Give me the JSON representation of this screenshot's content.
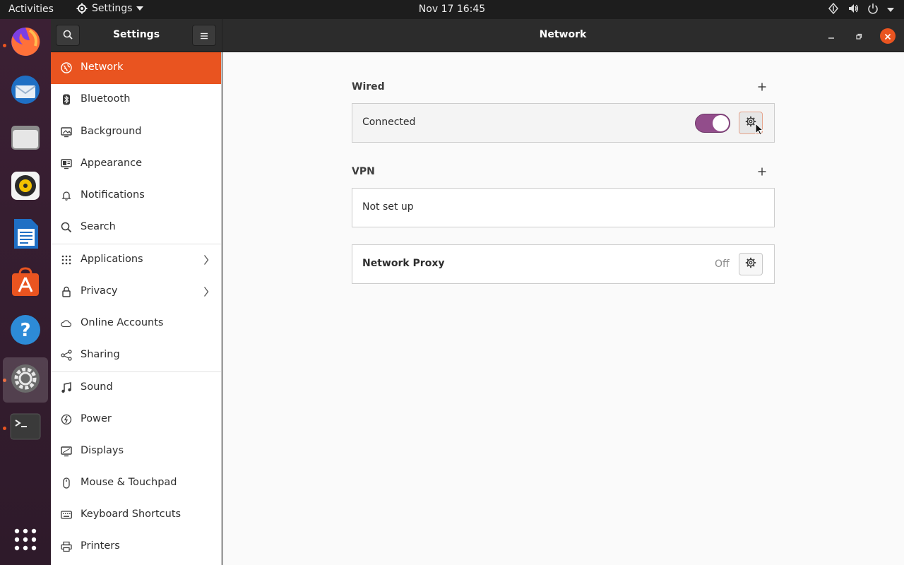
{
  "topbar": {
    "activities": "Activities",
    "app_menu": "Settings",
    "clock": "Nov 17  16:45"
  },
  "dock": {
    "items": [
      {
        "name": "Firefox",
        "icon": "firefox-icon",
        "running": true
      },
      {
        "name": "Thunderbird",
        "icon": "thunderbird-icon",
        "running": false
      },
      {
        "name": "Files",
        "icon": "files-icon",
        "running": false
      },
      {
        "name": "Rhythmbox",
        "icon": "rhythmbox-icon",
        "running": false
      },
      {
        "name": "LibreOffice Writer",
        "icon": "writer-icon",
        "running": false
      },
      {
        "name": "Ubuntu Software",
        "icon": "software-icon",
        "running": false
      },
      {
        "name": "Help",
        "icon": "help-icon",
        "running": false
      },
      {
        "name": "Settings",
        "icon": "settings-icon",
        "running": true,
        "active": true
      },
      {
        "name": "Terminal",
        "icon": "terminal-icon",
        "running": true
      }
    ],
    "show_apps": "show-apps-icon"
  },
  "header": {
    "sidebar_title": "Settings",
    "title": "Network"
  },
  "sidebar": {
    "items": [
      {
        "label": "Network",
        "icon": "network-icon",
        "selected": true
      },
      {
        "label": "Bluetooth",
        "icon": "bluetooth-icon"
      },
      {
        "label": "Background",
        "icon": "background-icon"
      },
      {
        "label": "Appearance",
        "icon": "appearance-icon"
      },
      {
        "label": "Notifications",
        "icon": "bell-icon"
      },
      {
        "label": "Search",
        "icon": "search-icon"
      },
      {
        "label": "Applications",
        "icon": "grid-icon",
        "submenu": true
      },
      {
        "label": "Privacy",
        "icon": "lock-icon",
        "submenu": true
      },
      {
        "label": "Online Accounts",
        "icon": "cloud-icon"
      },
      {
        "label": "Sharing",
        "icon": "share-icon"
      },
      {
        "label": "Sound",
        "icon": "music-note-icon"
      },
      {
        "label": "Power",
        "icon": "power-icon"
      },
      {
        "label": "Displays",
        "icon": "display-icon"
      },
      {
        "label": "Mouse & Touchpad",
        "icon": "mouse-icon"
      },
      {
        "label": "Keyboard Shortcuts",
        "icon": "keyboard-icon"
      },
      {
        "label": "Printers",
        "icon": "printer-icon"
      }
    ]
  },
  "main": {
    "wired": {
      "title": "Wired",
      "status": "Connected",
      "toggle_on": true
    },
    "vpn": {
      "title": "VPN",
      "status": "Not set up"
    },
    "proxy": {
      "title": "Network Proxy",
      "status": "Off"
    }
  },
  "colors": {
    "accent": "#e95420",
    "toggle": "#924d8b",
    "topbar": "#1d1d1d",
    "headerbar": "#2c2c2c",
    "dock": "#3b2034"
  }
}
